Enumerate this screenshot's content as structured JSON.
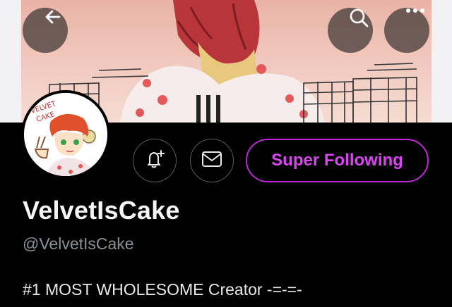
{
  "header": {
    "back_icon": "arrow-left-icon",
    "search_icon": "search-icon",
    "more_icon": "more-horizontal-icon"
  },
  "profile": {
    "avatar_text": "VELVET CAKE",
    "display_name": "VelvetIsCake",
    "handle": "@VelvetIsCake",
    "bio": "#1 MOST WHOLESOME Creator -=-=-"
  },
  "actions": {
    "notify_icon": "bell-plus-icon",
    "message_icon": "mail-icon",
    "super_following_label": "Super Following"
  },
  "colors": {
    "accent": "#d946ef",
    "background": "#000000"
  }
}
